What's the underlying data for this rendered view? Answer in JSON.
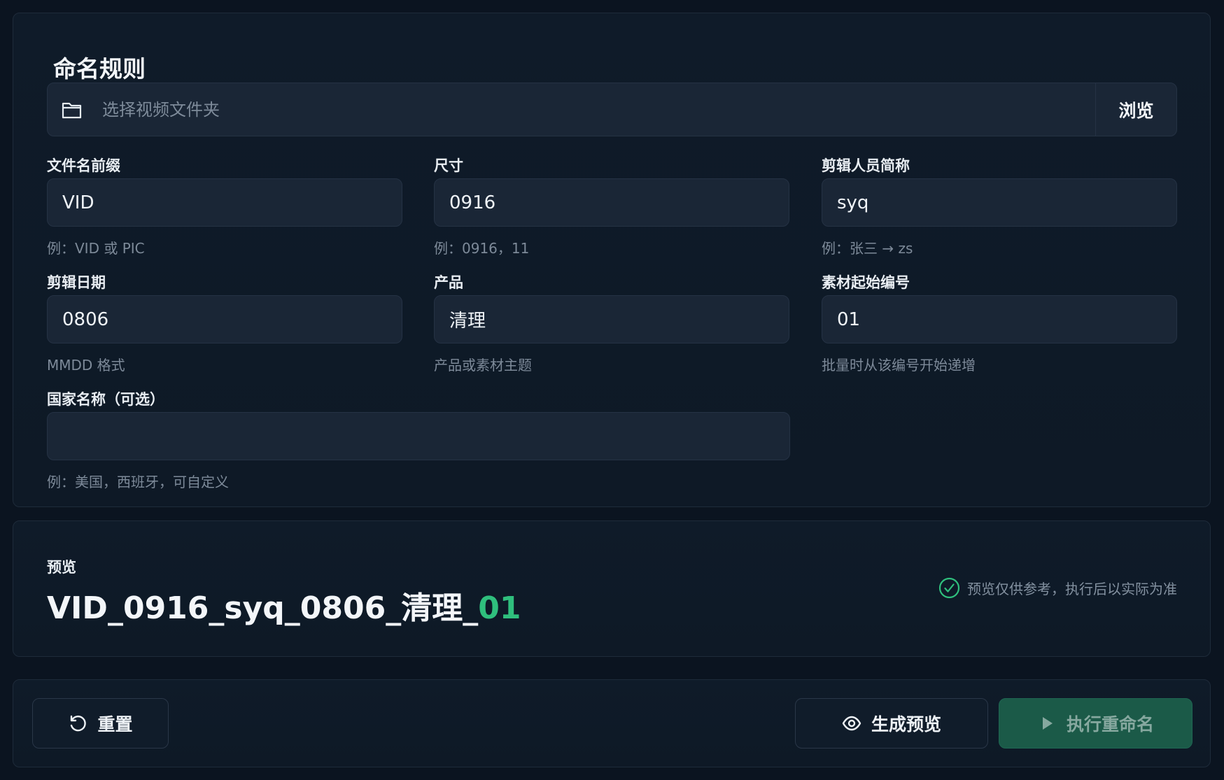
{
  "rules": {
    "title": "命名规则",
    "folder": {
      "placeholder": "选择视频文件夹",
      "value": "",
      "browse_label": "浏览"
    },
    "fields": [
      {
        "label": "文件名前缀",
        "value": "VID",
        "hint": "例：VID 或 PIC"
      },
      {
        "label": "尺寸",
        "value": "0916",
        "hint": "例：0916，11"
      },
      {
        "label": "剪辑人员简称",
        "value": "syq",
        "hint": "例：张三 → zs"
      },
      {
        "label": "剪辑日期",
        "value": "0806",
        "hint": "MMDD 格式"
      },
      {
        "label": "产品",
        "value": "清理",
        "hint": "产品或素材主题"
      },
      {
        "label": "素材起始编号",
        "value": "01",
        "hint": "批量时从该编号开始递增"
      },
      {
        "label": "国家名称（可选）",
        "value": "",
        "hint": "例：美国，西班牙，可自定义"
      }
    ]
  },
  "preview": {
    "label": "预览",
    "name_main": "VID_0916_syq_0806_清理_",
    "name_seq": "01",
    "note": "预览仅供参考，执行后以实际为准"
  },
  "actions": {
    "reset_label": "重置",
    "generate_label": "生成预览",
    "execute_label": "执行重命名"
  },
  "colors": {
    "accent_green": "#2fbf7d",
    "execute_bg": "#1b5a48"
  },
  "icons": {
    "folder": "folder-icon",
    "check": "check-circle-icon",
    "reset": "refresh-icon",
    "eye": "eye-icon",
    "play": "play-icon"
  }
}
